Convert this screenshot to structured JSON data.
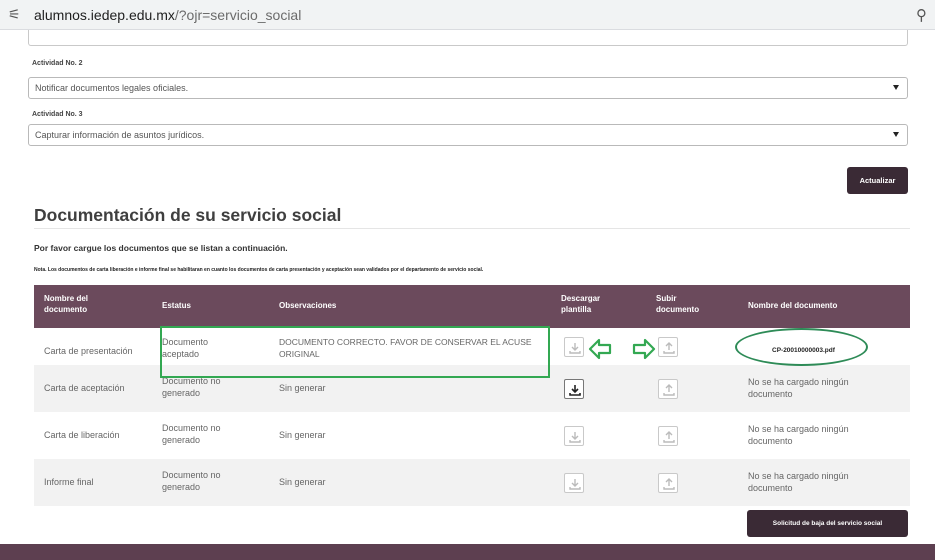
{
  "browser": {
    "url_domain": "alumnos.iedep.edu.mx",
    "url_path": "/?ojr=servicio_social",
    "tune_icon": "tune-icon",
    "zoom_icon": "magnifier-icon"
  },
  "activities": [
    {
      "label": "Actividad No. 2",
      "value": "Notificar documentos legales oficiales."
    },
    {
      "label": "Actividad No. 3",
      "value": "Capturar información de asuntos jurídicos."
    }
  ],
  "update_button": "Actualizar",
  "section": {
    "title": "Documentación de su servicio social",
    "intro": "Por favor cargue los documentos que se listan a continuación.",
    "note": "Nota. Los documentos de carta liberación e informe final se habilitaran en cuanto los documentos de carta presentación y aceptación sean validados por el departamento de servicio social."
  },
  "table": {
    "headers": {
      "name": "Nombre del documento",
      "status": "Estatus",
      "obs": "Observaciones",
      "download": "Descargar plantilla",
      "upload": "Subir documento",
      "filename": "Nombre del documento"
    },
    "rows": [
      {
        "name": "Carta de presentación",
        "status": "Documento aceptado",
        "obs": "DOCUMENTO CORRECTO. FAVOR DE CONSERVAR EL ACUSE ORIGINAL",
        "file": "CP-20010000003.pdf",
        "download_active": false,
        "upload_active": false
      },
      {
        "name": "Carta de aceptación",
        "status": "Documento no generado",
        "obs": "Sin generar",
        "file": "No se ha cargado ningún documento",
        "download_active": true,
        "upload_active": false
      },
      {
        "name": "Carta de liberación",
        "status": "Documento no generado",
        "obs": "Sin generar",
        "file": "No se ha cargado ningún documento",
        "download_active": false,
        "upload_active": false
      },
      {
        "name": "Informe final",
        "status": "Documento no generado",
        "obs": "Sin generar",
        "file": "No se ha cargado ningún documento",
        "download_active": false,
        "upload_active": false
      }
    ]
  },
  "request_button": "Solicitud de baja del servicio social",
  "colors": {
    "header": "#6b4a5c",
    "button": "#3a2a35",
    "annotation": "#33a852"
  }
}
